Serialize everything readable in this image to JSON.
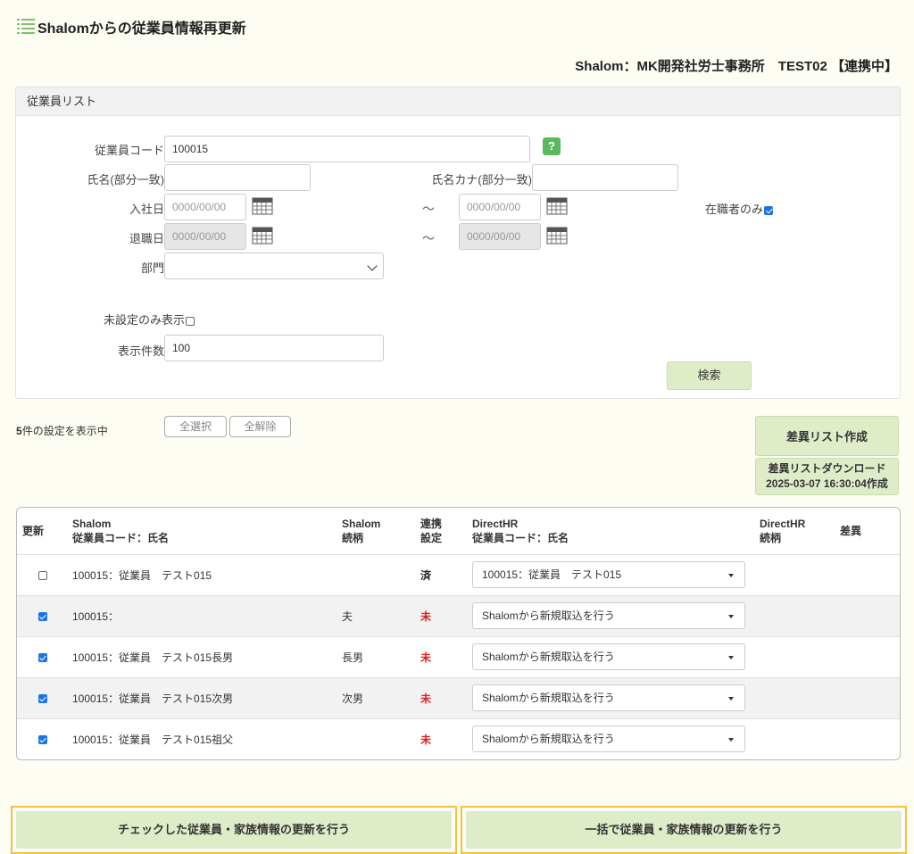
{
  "header": {
    "title": "Shalomからの従業員情報再更新",
    "connection": "Shalom：MK開発社労士事務所　TEST02 【連携中】"
  },
  "search_panel": {
    "title": "従業員リスト",
    "employee_code_label": "従業員コード",
    "employee_code_value": "100015",
    "help_label": "?",
    "name_label": "氏名(部分一致)",
    "name_kana_label": "氏名カナ(部分一致)",
    "hire_date_label": "入社日",
    "retire_date_label": "退職日",
    "date_placeholder": "0000/00/00",
    "range_sep": "～",
    "active_only_label": "在職者のみ",
    "dept_label": "部門",
    "unset_only_label": "未設定のみ表示",
    "display_count_label": "表示件数",
    "display_count_value": "100",
    "search_button": "検索"
  },
  "result": {
    "count": "5",
    "count_suffix": "件の設定を表示中",
    "select_all": "全選択",
    "deselect_all": "全解除",
    "diff_create": "差異リスト作成",
    "diff_download": "差異リストダウンロード",
    "diff_timestamp": "2025-03-07 16:30:04作成"
  },
  "table": {
    "headers": {
      "update": "更新",
      "shalom_line1": "Shalom",
      "shalom_line2": "従業員コード：氏名",
      "shalom_rel_line1": "Shalom",
      "shalom_rel_line2": "続柄",
      "link_line1": "連携",
      "link_line2": "設定",
      "dhr_line1": "DirectHR",
      "dhr_line2": "従業員コード：氏名",
      "dhr_rel_line1": "DirectHR",
      "dhr_rel_line2": "続柄",
      "diff": "差異"
    },
    "rows": [
      {
        "checked": false,
        "shalom": "100015：従業員　テスト015",
        "relation": "",
        "status": "済",
        "directhr": "100015：従業員　テスト015"
      },
      {
        "checked": true,
        "shalom": "100015：",
        "relation": "夫",
        "status": "未",
        "directhr": "Shalomから新規取込を行う"
      },
      {
        "checked": true,
        "shalom": "100015：従業員　テスト015長男",
        "relation": "長男",
        "status": "未",
        "directhr": "Shalomから新規取込を行う"
      },
      {
        "checked": true,
        "shalom": "100015：従業員　テスト015次男",
        "relation": "次男",
        "status": "未",
        "directhr": "Shalomから新規取込を行う"
      },
      {
        "checked": true,
        "shalom": "100015：従業員　テスト015祖父",
        "relation": "",
        "status": "未",
        "directhr": "Shalomから新規取込を行う"
      }
    ]
  },
  "actions": {
    "update_checked": "チェックした従業員・家族情報の更新を行う",
    "update_all": "一括で従業員・家族情報の更新を行う"
  },
  "colors": {
    "accent_green": "#dfecc8",
    "highlight_border": "#f3c13a",
    "status_red": "#e02020"
  }
}
